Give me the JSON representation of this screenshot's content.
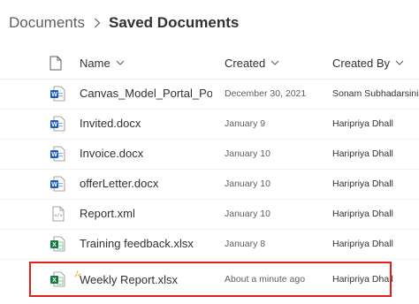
{
  "breadcrumb": {
    "root": "Documents",
    "current": "Saved Documents"
  },
  "columns": {
    "name": "Name",
    "created": "Created",
    "created_by": "Created By"
  },
  "files": [
    {
      "name": "Canvas_Model_Portal_Powe...",
      "created": "December 30, 2021",
      "created_by": "Sonam Subhadarsini",
      "type": "word"
    },
    {
      "name": "Invited.docx",
      "created": "January 9",
      "created_by": "Haripriya Dhall",
      "type": "word"
    },
    {
      "name": "Invoice.docx",
      "created": "January 10",
      "created_by": "Haripriya Dhall",
      "type": "word"
    },
    {
      "name": "offerLetter.docx",
      "created": "January 10",
      "created_by": "Haripriya Dhall",
      "type": "word"
    },
    {
      "name": "Report.xml",
      "created": "January 10",
      "created_by": "Haripriya Dhall",
      "type": "xml"
    },
    {
      "name": "Training feedback.xlsx",
      "created": "January 8",
      "created_by": "Haripriya Dhall",
      "type": "excel"
    },
    {
      "name": "Weekly Report.xlsx",
      "created": "About a minute ago",
      "created_by": "Haripriya Dhall",
      "type": "excel"
    }
  ],
  "colors": {
    "highlight": "#e0201b",
    "word": "#185abd",
    "excel": "#107c41"
  },
  "icons": {
    "breadcrumb_separator": "chevron-right-icon",
    "file_type_header": "document-icon",
    "sort": "chevron-down-icon",
    "new_item": "sparkle-icon"
  }
}
